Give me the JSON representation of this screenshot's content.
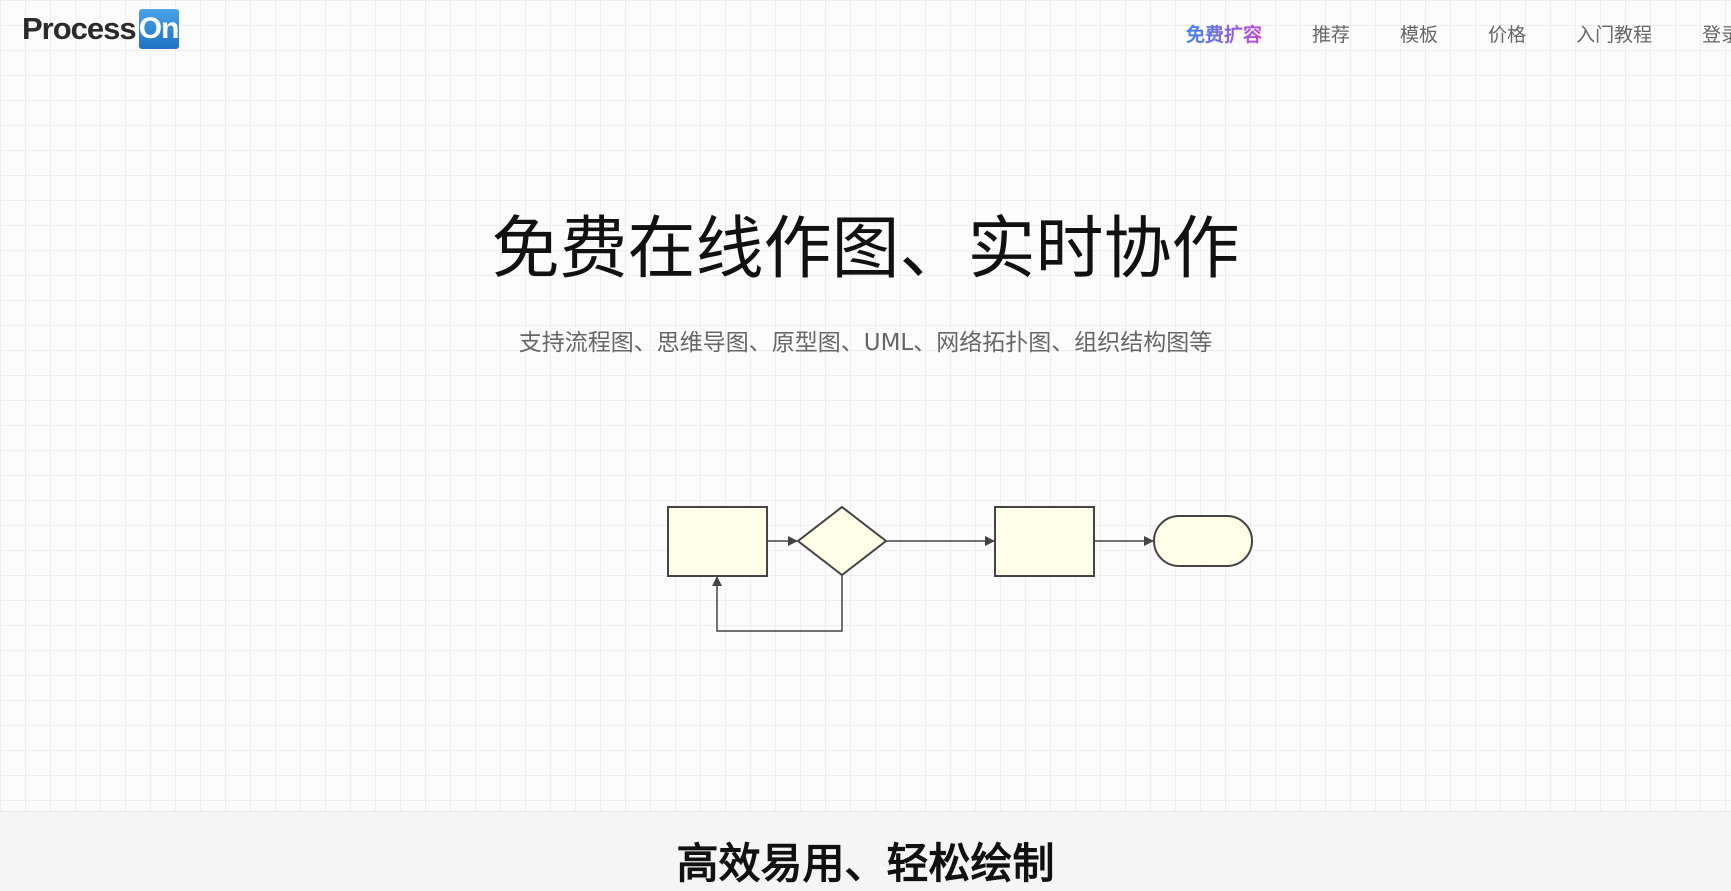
{
  "header": {
    "logo_text": "Process",
    "logo_badge": "On",
    "nav": [
      {
        "label": "免费扩容",
        "promo": true
      },
      {
        "label": "推荐"
      },
      {
        "label": "模板"
      },
      {
        "label": "价格"
      },
      {
        "label": "入门教程"
      },
      {
        "label": "登录"
      }
    ]
  },
  "hero": {
    "title": "免费在线作图、实时协作",
    "subtitle": "支持流程图、思维导图、原型图、UML、网络拓扑图、组织结构图等"
  },
  "diagram": {
    "shape_fill": "#fefee6",
    "stroke": "#444444"
  },
  "section": {
    "title": "高效易用、轻松绘制"
  }
}
